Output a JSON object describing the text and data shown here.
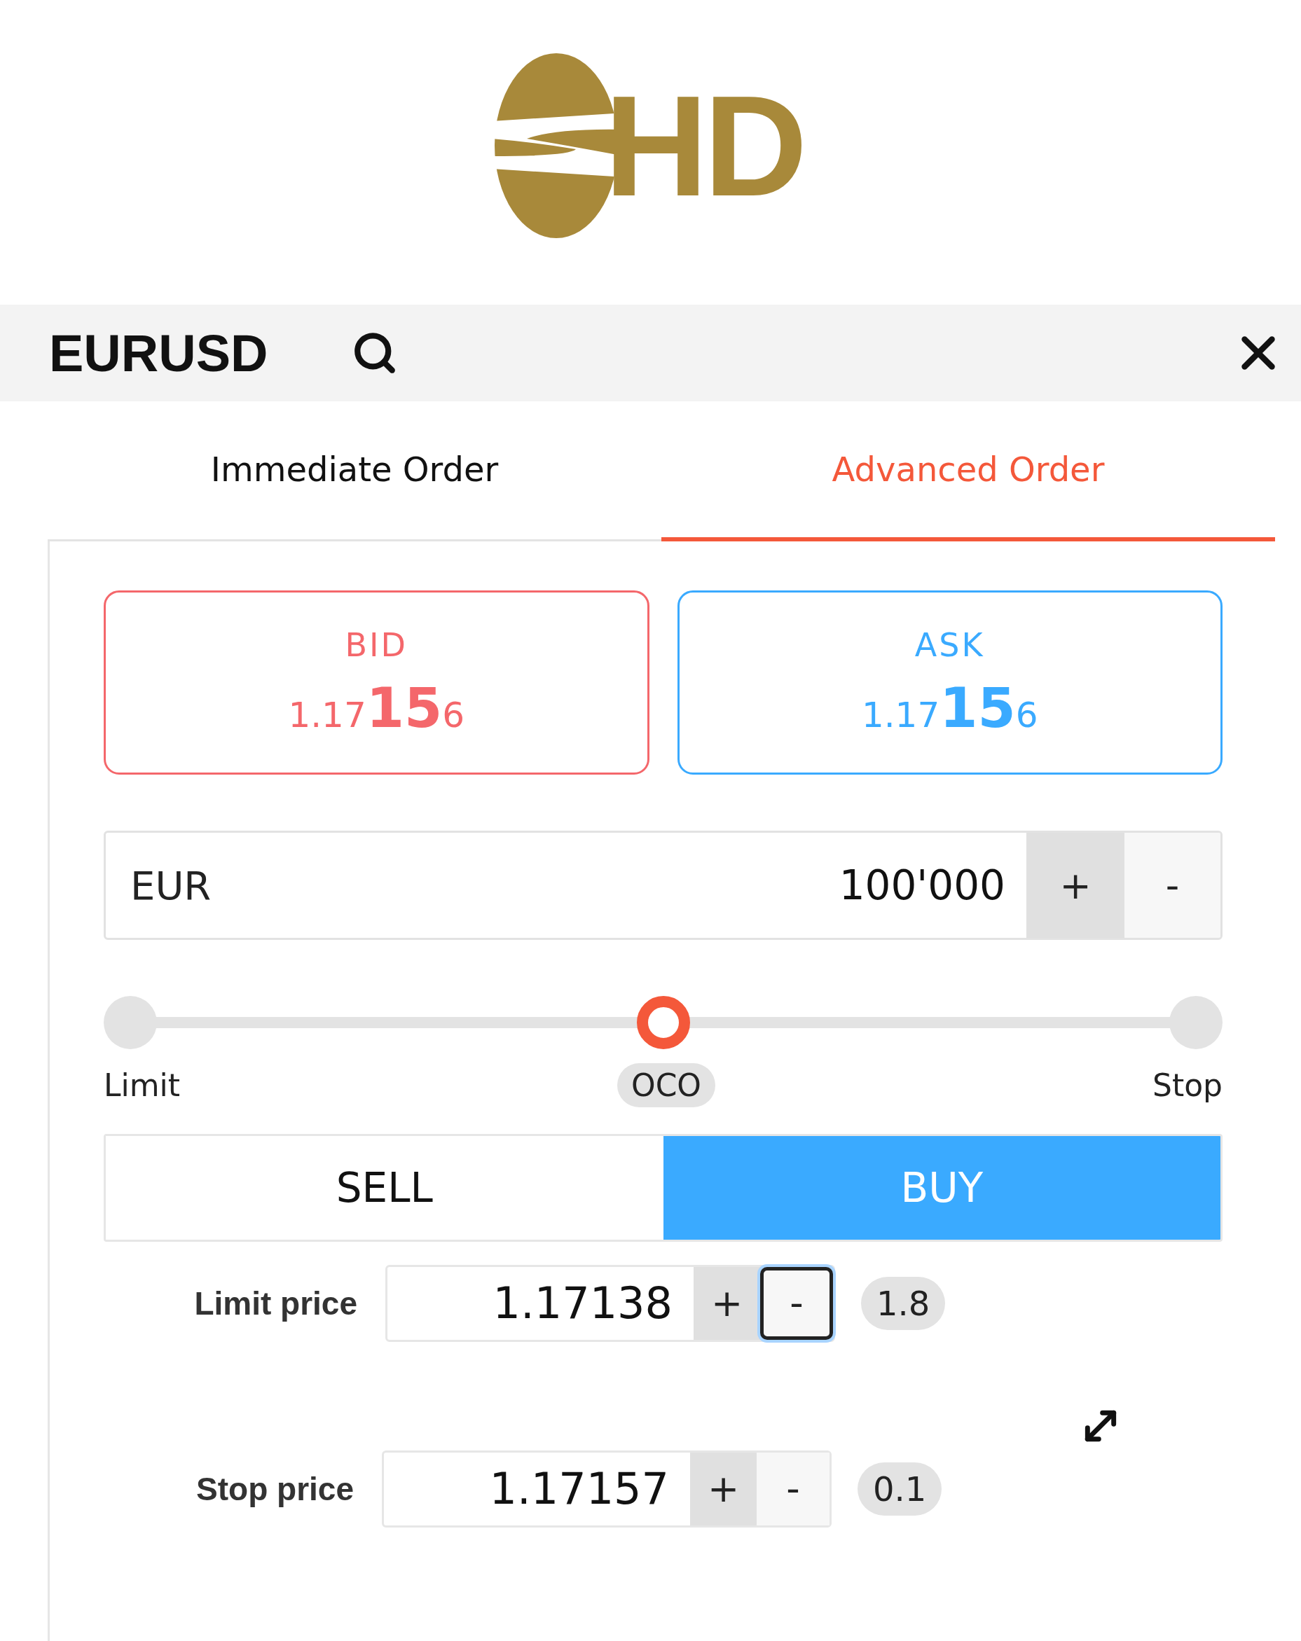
{
  "logo": {
    "text": "HD"
  },
  "header": {
    "symbol": "EURUSD"
  },
  "tabs": [
    {
      "label": "Immediate Order",
      "selected": false
    },
    {
      "label": "Advanced Order",
      "selected": true
    }
  ],
  "quotes": [
    {
      "kind": "bid",
      "label": "BID",
      "price_head": "1.17",
      "price_pips": "15",
      "price_tail": "6"
    },
    {
      "kind": "ask",
      "label": "ASK",
      "price_head": "1.17",
      "price_pips": "15",
      "price_tail": "6"
    }
  ],
  "amount": {
    "currency": "EUR",
    "value": "100'000",
    "plus": "+",
    "minus": "-"
  },
  "order_types": [
    {
      "label": "Limit",
      "selected": false
    },
    {
      "label": "OCO",
      "selected": true
    },
    {
      "label": "Stop",
      "selected": false
    }
  ],
  "sides": [
    {
      "label": "SELL",
      "selected": false
    },
    {
      "label": "BUY",
      "selected": true
    }
  ],
  "prices": [
    {
      "label": "Limit price",
      "value": "1.17138",
      "plus": "+",
      "minus": "-",
      "minus_focused": true,
      "distance": "1.8"
    },
    {
      "label": "Stop price",
      "value": "1.17157",
      "plus": "+",
      "minus": "-",
      "minus_focused": false,
      "distance": "0.1"
    }
  ]
}
